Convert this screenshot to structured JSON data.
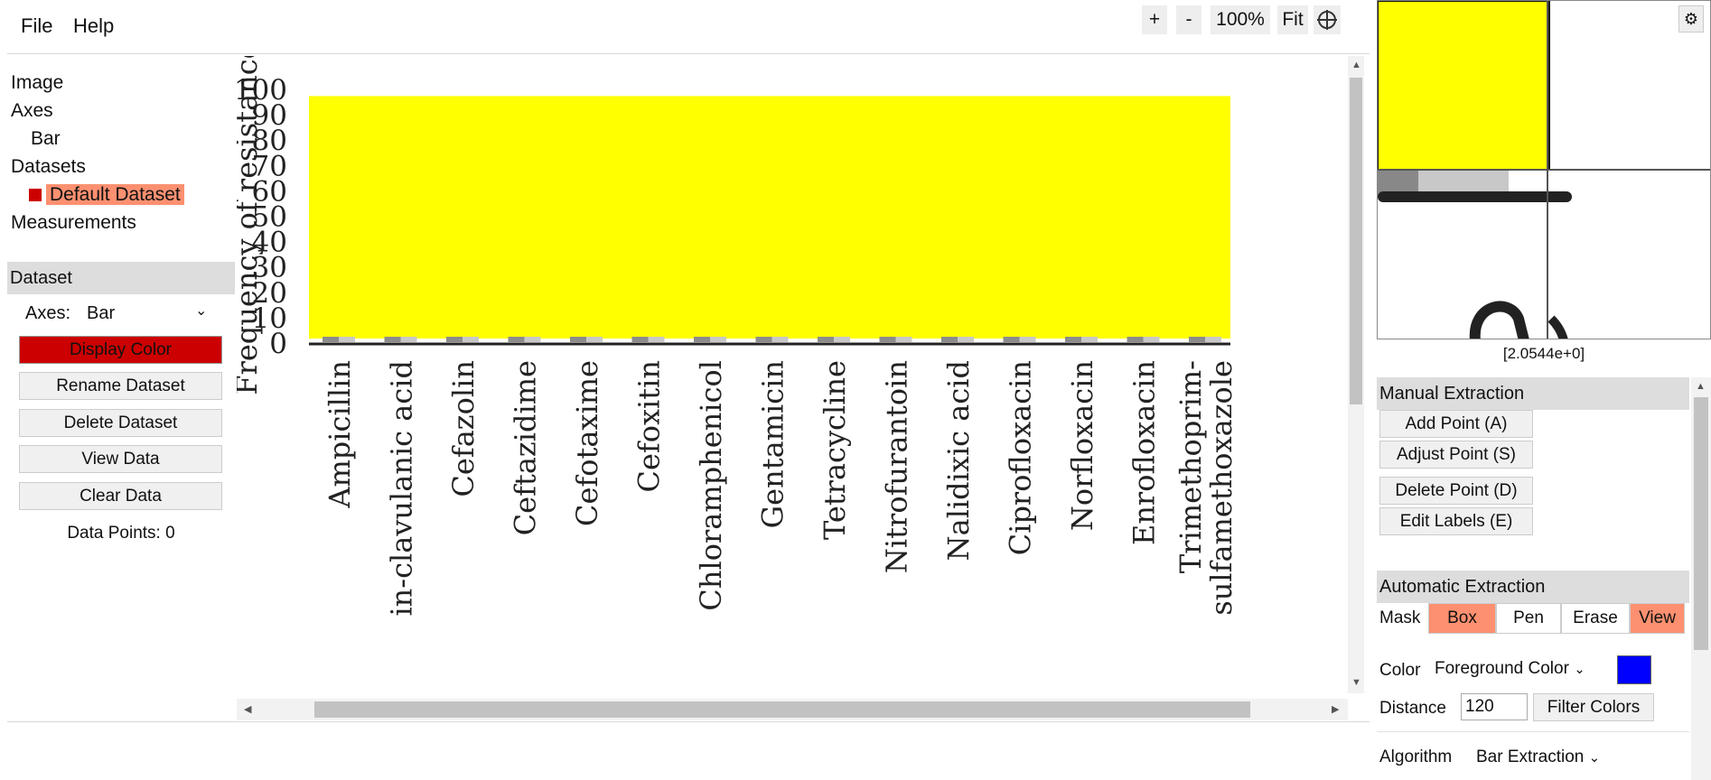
{
  "menu": {
    "file": "File",
    "help": "Help"
  },
  "zoom": {
    "plus": "+",
    "minus": "-",
    "level": "100%",
    "fit": "Fit"
  },
  "tree": {
    "image": "Image",
    "axes": "Axes",
    "axes_child": "Bar",
    "datasets": "Datasets",
    "dataset_child": "Default Dataset",
    "measurements": "Measurements"
  },
  "dataset_panel": {
    "header": "Dataset",
    "axes_label": "Axes:",
    "axes_value": "Bar",
    "display_color": "Display Color",
    "rename": "Rename Dataset",
    "delete": "Delete Dataset",
    "view_data": "View Data",
    "clear_data": "Clear Data",
    "data_points": "Data Points: 0"
  },
  "colors": {
    "dataset": "#cc0000",
    "active": "#fc9070",
    "bar_fill": "#ffff00",
    "foreground": "#0000ff"
  },
  "chart_data": {
    "type": "bar",
    "ylabel": "Frequency of resistance",
    "ylim": [
      0,
      100
    ],
    "yticks": [
      0,
      10,
      20,
      30,
      40,
      50,
      60,
      70,
      80,
      90,
      100
    ],
    "categories": [
      "Ampicillin",
      "in-clavulanic acid",
      "Cefazolin",
      "Ceftazidime",
      "Cefotaxime",
      "Cefoxitin",
      "Chloramphenicol",
      "Gentamicin",
      "Tetracycline",
      "Nitrofurantoin",
      "Nalidixic acid",
      "Ciprofloxacin",
      "Norfloxacin",
      "Enrofloxacin",
      "Trimethoprim-sulfamethoxazole"
    ],
    "category_lines": [
      [
        "Ampicillin"
      ],
      [
        "in-clavulanic acid"
      ],
      [
        "Cefazolin"
      ],
      [
        "Ceftazidime"
      ],
      [
        "Cefotaxime"
      ],
      [
        "Cefoxitin"
      ],
      [
        "Chloramphenicol"
      ],
      [
        "Gentamicin"
      ],
      [
        "Tetracycline"
      ],
      [
        "Nitrofurantoin"
      ],
      [
        "Nalidixic acid"
      ],
      [
        "Ciprofloxacin"
      ],
      [
        "Norfloxacin"
      ],
      [
        "Enrofloxacin"
      ],
      [
        "Trimethoprim-",
        "sulfamethoxazole"
      ]
    ],
    "highlight_fill": "#ffff00",
    "highlight_range": [
      0,
      97
    ]
  },
  "magnifier": {
    "coords": "[2.0544e+0]"
  },
  "manual": {
    "header": "Manual Extraction",
    "add": "Add Point (A)",
    "adjust": "Adjust Point (S)",
    "delete": "Delete Point (D)",
    "edit_labels": "Edit Labels (E)"
  },
  "auto": {
    "header": "Automatic Extraction",
    "mask_label": "Mask",
    "mask_options": [
      "Box",
      "Pen",
      "Erase",
      "View"
    ],
    "color_label": "Color",
    "color_mode": "Foreground Color",
    "distance_label": "Distance",
    "distance_value": "120",
    "filter_colors": "Filter Colors",
    "algorithm_label": "Algorithm",
    "algorithm_value": "Bar Extraction"
  }
}
